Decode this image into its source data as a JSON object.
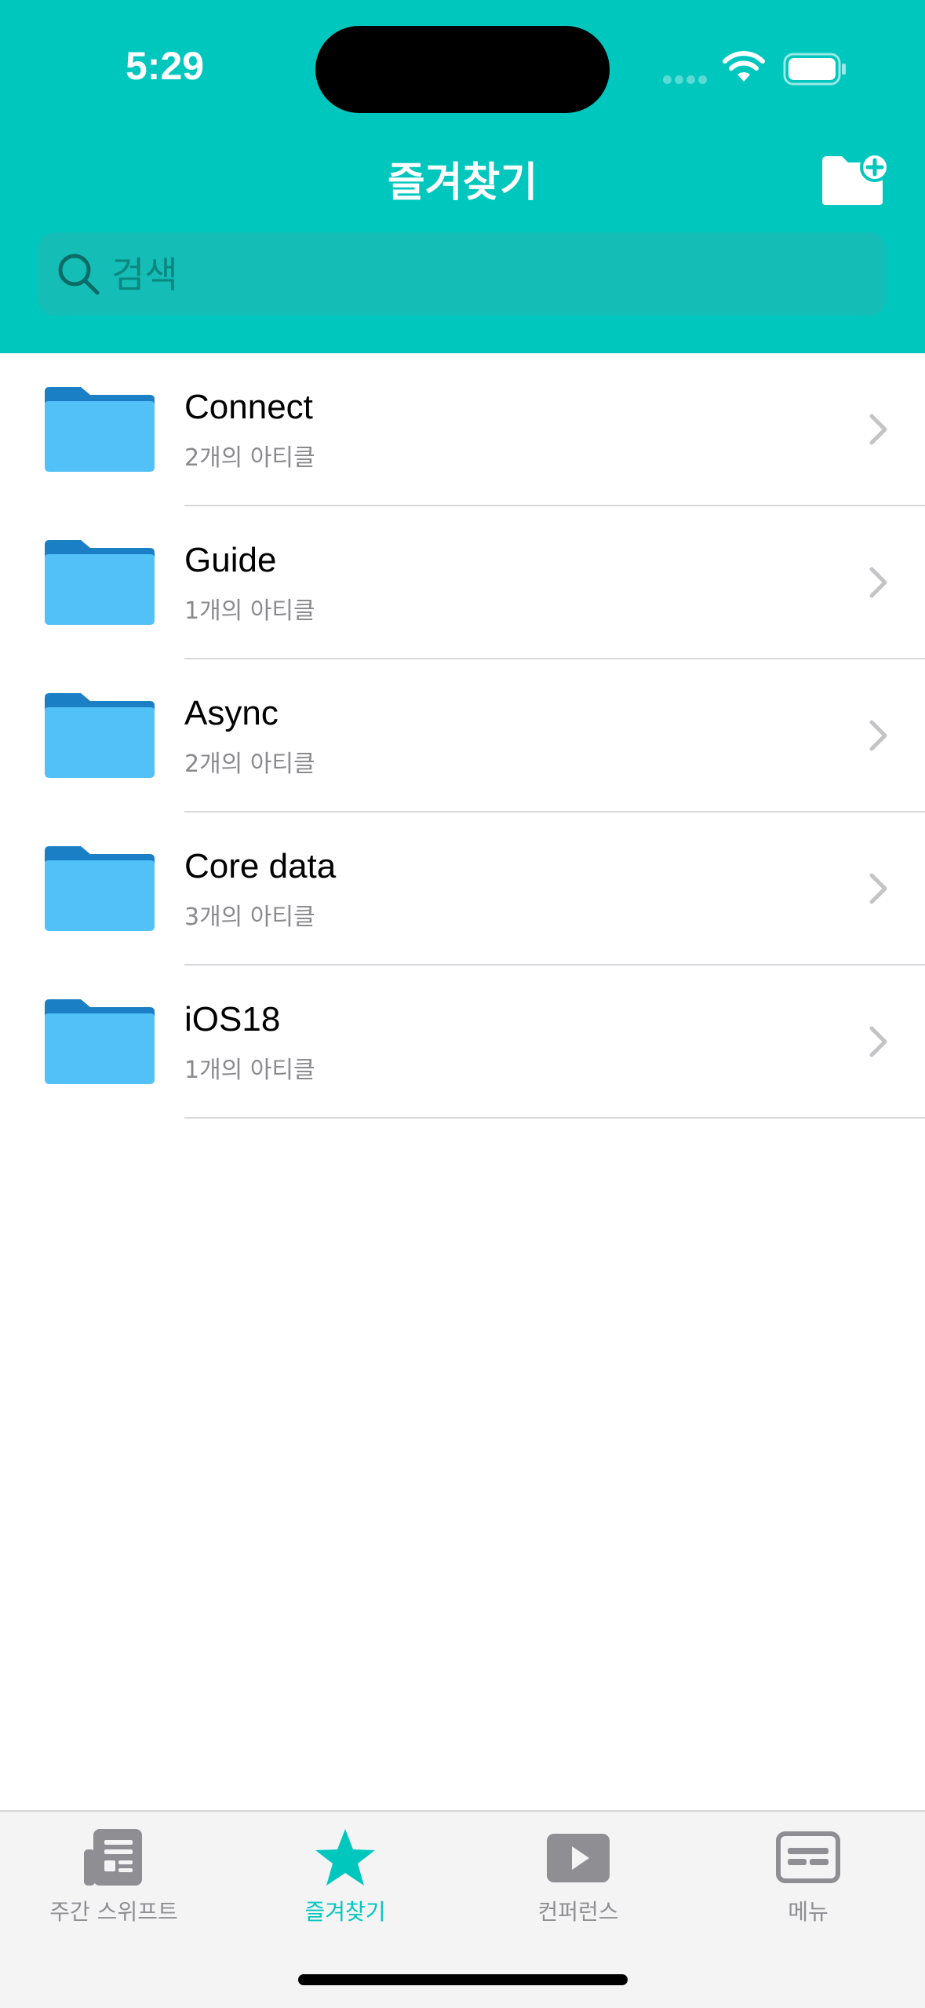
{
  "status_bar": {
    "time": "5:29"
  },
  "nav": {
    "title": "즐겨찾기",
    "add_folder_icon": "folder-plus-icon"
  },
  "search": {
    "placeholder": "검색",
    "value": ""
  },
  "folders": [
    {
      "name": "Connect",
      "count": "2개의 아티클"
    },
    {
      "name": "Guide",
      "count": "1개의 아티클"
    },
    {
      "name": "Async",
      "count": "2개의 아티클"
    },
    {
      "name": "Core data",
      "count": "3개의 아티클"
    },
    {
      "name": "iOS18",
      "count": "1개의 아티클"
    }
  ],
  "tabs": [
    {
      "label": "주간 스위프트",
      "icon": "newspaper-icon",
      "active": false
    },
    {
      "label": "즐겨찾기",
      "icon": "star-icon",
      "active": true
    },
    {
      "label": "컨퍼런스",
      "icon": "play-icon",
      "active": false
    },
    {
      "label": "메뉴",
      "icon": "menu-card-icon",
      "active": false
    }
  ],
  "colors": {
    "accent": "#00c7be",
    "folder": "#52c1f8",
    "folder_tab": "#1a7fc4",
    "inactive": "#8e8e93"
  }
}
